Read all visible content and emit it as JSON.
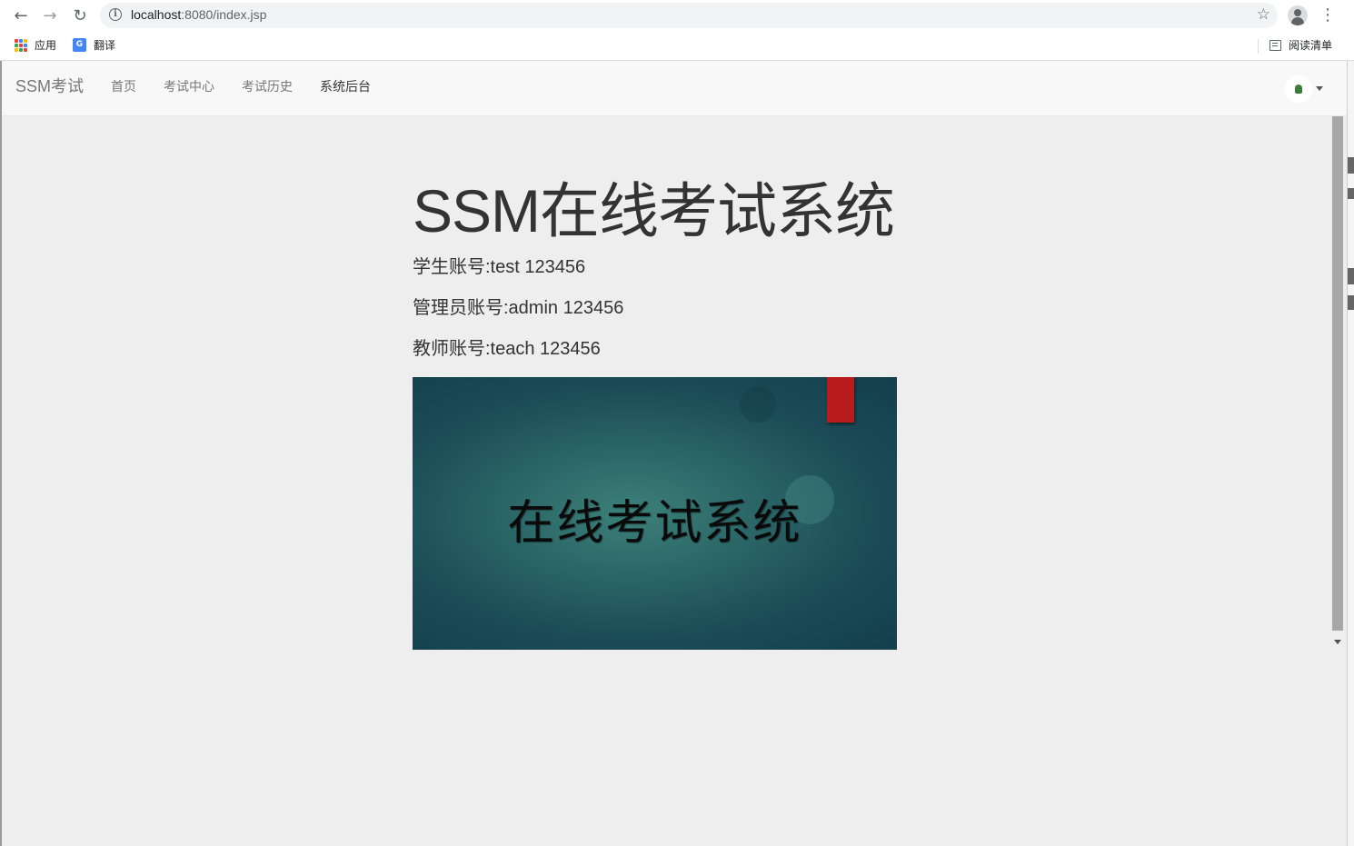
{
  "browser": {
    "url_host": "localhost",
    "url_rest": ":8080/index.jsp",
    "bookmarks": {
      "apps_label": "应用",
      "translate_label": "翻译",
      "reading_list_label": "阅读清单"
    }
  },
  "navbar": {
    "brand": "SSM考试",
    "links": [
      "首页",
      "考试中心",
      "考试历史",
      "系统后台"
    ]
  },
  "main": {
    "title": "SSM在线考试系统",
    "accounts": [
      "学生账号:test 123456",
      "管理员账号:admin 123456",
      "教师账号:teach 123456"
    ],
    "banner_text": "在线考试系统"
  },
  "colors": {
    "page_bg": "#eeeeee",
    "navbar_bg": "#f8f8f8",
    "banner_teal": "#2a6466",
    "bookmark_red": "#b81c1c"
  }
}
